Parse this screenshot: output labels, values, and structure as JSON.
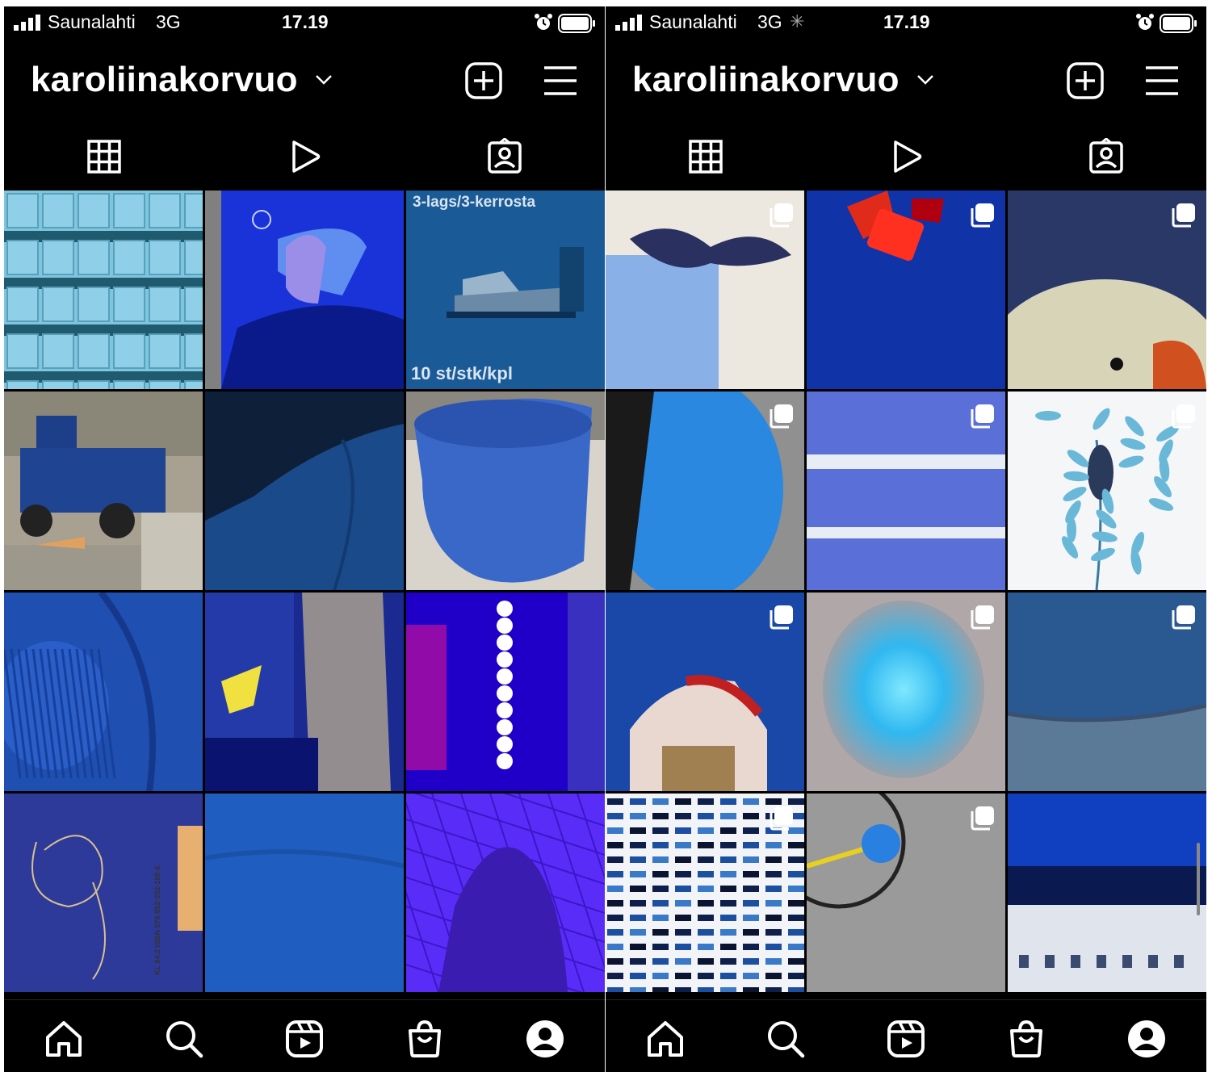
{
  "screens": [
    {
      "status": {
        "carrier": "Saunalahti",
        "network": "3G",
        "time": "17.19"
      },
      "header": {
        "username": "karoliinakorvuo"
      },
      "tabs": [
        "posts",
        "reels",
        "tagged"
      ],
      "tiles": [
        {
          "type": "tiles",
          "multi": false
        },
        {
          "type": "phone-selfie",
          "multi": false
        },
        {
          "type": "shelf",
          "multi": false,
          "text_top": "3-lags/3-kerrosta",
          "text_bottom": "10 st/stk/kpl"
        },
        {
          "type": "tractor",
          "multi": false
        },
        {
          "type": "fabric-dark",
          "multi": false
        },
        {
          "type": "mug",
          "multi": false
        },
        {
          "type": "sweater",
          "multi": false
        },
        {
          "type": "wall",
          "multi": false
        },
        {
          "type": "lights",
          "multi": false
        },
        {
          "type": "book",
          "multi": false,
          "isbn": "KL 84.2 ISBN 978-952-352-105-6"
        },
        {
          "type": "fabric-blue",
          "multi": false
        },
        {
          "type": "shadow",
          "multi": false
        }
      ],
      "nav": [
        "home",
        "search",
        "reels",
        "shop",
        "profile"
      ],
      "scrollbar": false
    },
    {
      "status": {
        "carrier": "Saunalahti",
        "network": "3G",
        "time": "17.19",
        "loading": true
      },
      "header": {
        "username": "karoliinakorvuo"
      },
      "tabs": [
        "posts",
        "reels",
        "tagged"
      ],
      "tiles": [
        {
          "type": "moth",
          "multi": true
        },
        {
          "type": "candy",
          "multi": true
        },
        {
          "type": "bird",
          "multi": true
        },
        {
          "type": "pipe",
          "multi": true
        },
        {
          "type": "stripes",
          "multi": true
        },
        {
          "type": "plant",
          "multi": true
        },
        {
          "type": "bag",
          "multi": true
        },
        {
          "type": "blur",
          "multi": true
        },
        {
          "type": "denim",
          "multi": true
        },
        {
          "type": "pattern",
          "multi": true
        },
        {
          "type": "bike",
          "multi": true
        },
        {
          "type": "laptop",
          "multi": false
        }
      ],
      "nav": [
        "home",
        "search",
        "reels",
        "shop",
        "profile"
      ],
      "scrollbar": true
    }
  ]
}
